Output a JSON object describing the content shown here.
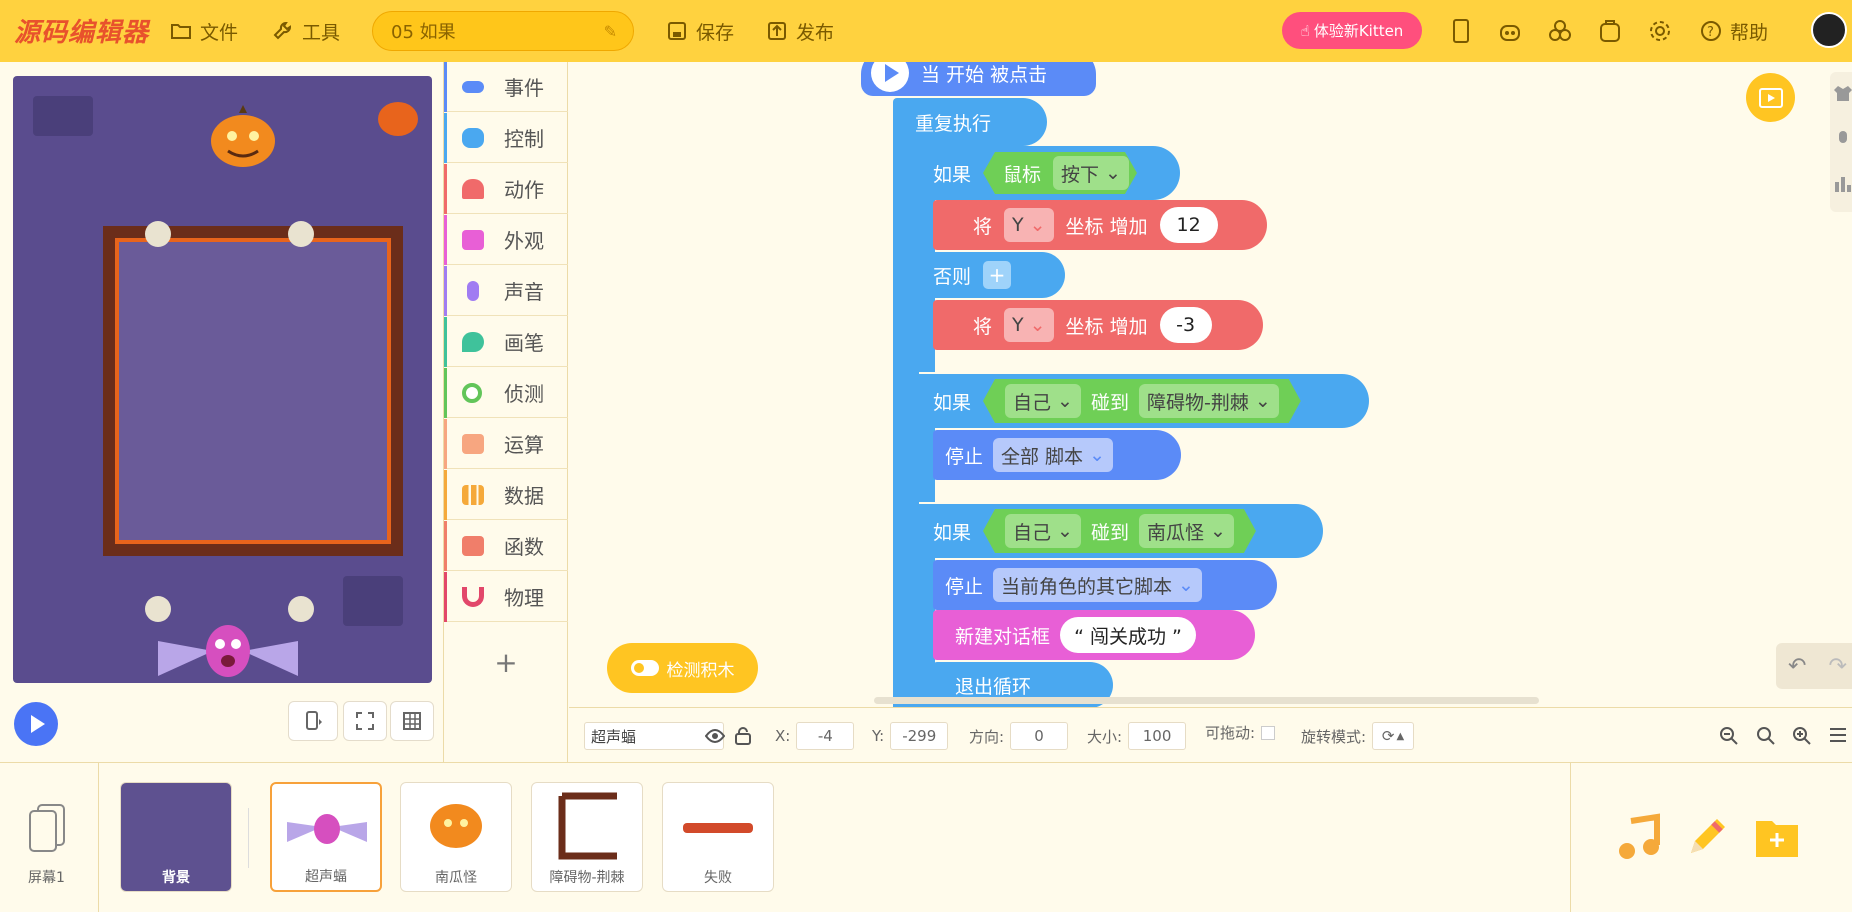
{
  "app": {
    "logo": "源码编辑器",
    "menu_file": "文件",
    "menu_tools": "工具",
    "project_name": "05 如果",
    "save": "保存",
    "publish": "发布",
    "kitten_button": "体验新Kitten",
    "help": "帮助"
  },
  "categories": [
    {
      "label": "事件",
      "color": "#5b8bf7"
    },
    {
      "label": "控制",
      "color": "#4aa8f0"
    },
    {
      "label": "动作",
      "color": "#f06a6a"
    },
    {
      "label": "外观",
      "color": "#e85fd6"
    },
    {
      "label": "声音",
      "color": "#a07cf2"
    },
    {
      "label": "画笔",
      "color": "#3fc29b"
    },
    {
      "label": "侦测",
      "color": "#62c55a"
    },
    {
      "label": "运算",
      "color": "#f7a680"
    },
    {
      "label": "数据",
      "color": "#f5a93a"
    },
    {
      "label": "函数",
      "color": "#f07e6a"
    },
    {
      "label": "物理",
      "color": "#e2476a"
    }
  ],
  "blocks": {
    "start": "当 开始 被点击",
    "forever": "重复执行",
    "if1": {
      "label": "如果",
      "sensor": "鼠标",
      "state": "按下"
    },
    "move1": {
      "prefix": "将",
      "axis": "Y",
      "mid": "坐标 增加",
      "value": "12"
    },
    "else": "否则",
    "move2": {
      "prefix": "将",
      "axis": "Y",
      "mid": "坐标 增加",
      "value": "-3"
    },
    "if2": {
      "label": "如果",
      "who": "自己",
      "mid": "碰到",
      "target": "障碍物-荆棘"
    },
    "stop1": {
      "label": "停止",
      "option": "全部 脚本"
    },
    "if3": {
      "label": "如果",
      "who": "自己",
      "mid": "碰到",
      "target": "南瓜怪"
    },
    "stop2": {
      "label": "停止",
      "option": "当前角色的其它脚本"
    },
    "dialog": {
      "label": "新建对话框",
      "text": "“ 闯关成功 ”"
    },
    "exit": "退出循环"
  },
  "check_button": "检测积木",
  "props": {
    "sprite_name": "超声蝠",
    "x_label": "X:",
    "x": "-4",
    "y_label": "Y:",
    "y": "-299",
    "dir_label": "方向:",
    "dir": "0",
    "size_label": "大小:",
    "size": "100",
    "drag_label": "可拖动:",
    "rotate_label": "旋转模式:"
  },
  "screen_label": "屏幕1",
  "sprites": [
    {
      "name": "背景",
      "color": "#5e5190"
    },
    {
      "name": "超声蝠",
      "color": "#d64fbf"
    },
    {
      "name": "南瓜怪",
      "color": "#f28a1e"
    },
    {
      "name": "障碍物-荆棘",
      "color": "#6b2d1a"
    },
    {
      "name": "失败",
      "color": "#d24a2a"
    }
  ]
}
